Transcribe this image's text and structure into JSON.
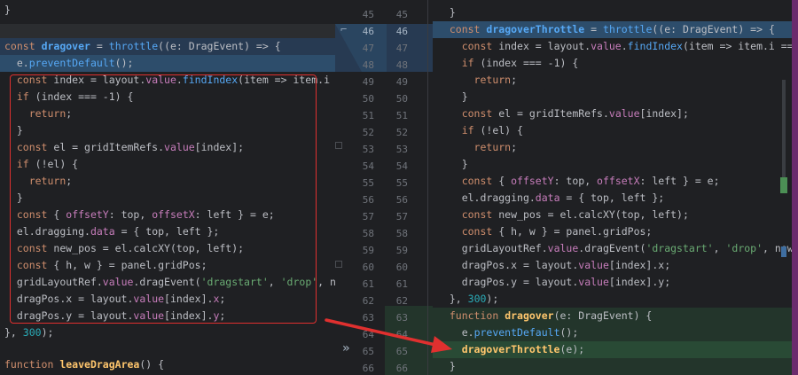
{
  "left": {
    "line_top": "}",
    "line_declare": [
      "const",
      "dragover",
      "=",
      "throttle",
      "((e: DragEvent) => {"
    ],
    "l_prevent": [
      "e.",
      "preventDefault",
      "();"
    ],
    "l_index": [
      "const index = layout.",
      "value",
      ".",
      "findIndex",
      "(item => item.i =="
    ],
    "l_if1": [
      "if",
      " (index === -1) {"
    ],
    "l_return1": [
      "return",
      ";"
    ],
    "l_close1": "}",
    "l_el": [
      "const el = gridItemRefs.",
      "value",
      "[index];"
    ],
    "l_if2": [
      "if",
      " (!el) {"
    ],
    "l_return2": [
      "return",
      ";"
    ],
    "l_close2": "}",
    "l_offset": [
      "const { ",
      "offsetY",
      ": top, ",
      "offsetX",
      ": left } = e;"
    ],
    "l_dragging": [
      "el.dragging.",
      "data",
      " = { top, left };"
    ],
    "l_newpos": [
      "const new_pos = el.calcXY(top, left);"
    ],
    "l_hw": [
      "const { h, w } = panel.gridPos;"
    ],
    "l_grid": [
      "gridLayoutRef.",
      "value",
      ".dragEvent(",
      "'dragstart'",
      ", ",
      "'drop'",
      ", new"
    ],
    "l_dragx": [
      "dragPos.x = layout.",
      "value",
      "[index].",
      "x",
      ";"
    ],
    "l_dragy": [
      "dragPos.y = layout.",
      "value",
      "[index].",
      "y",
      ";"
    ],
    "l_end": [
      "}, ",
      "300",
      ");"
    ],
    "l_leave": [
      "function",
      "leaveDragArea",
      "() {"
    ]
  },
  "gutter": {
    "left_numbers": [
      "45",
      "46",
      "47",
      "48",
      "49",
      "50",
      "51",
      "52",
      "53",
      "54",
      "55",
      "56",
      "57",
      "58",
      "59",
      "60",
      "61",
      "62",
      "63",
      "64",
      "65",
      "66"
    ],
    "right_numbers": [
      "45",
      "46",
      "47",
      "48",
      "49",
      "50",
      "51",
      "52",
      "53",
      "54",
      "55",
      "56",
      "57",
      "58",
      "59",
      "60",
      "61",
      "62",
      "63",
      "64",
      "65",
      "66"
    ],
    "chevron": "»"
  },
  "right": {
    "r_close": "}",
    "r_declare": [
      "const",
      "dragoverThrottle",
      "=",
      "throttle",
      "((e: DragEvent) => {"
    ],
    "r_index": [
      "const index = layout.",
      "value",
      ".",
      "findIndex",
      "(item => item.i ==="
    ],
    "r_if1": [
      "if",
      " (index === -1) {"
    ],
    "r_return1": [
      "return",
      ";"
    ],
    "r_close1": "}",
    "r_el": [
      "const el = gridItemRefs.",
      "value",
      "[index];"
    ],
    "r_if2": [
      "if",
      " (!el) {"
    ],
    "r_return2": [
      "return",
      ";"
    ],
    "r_close2": "}",
    "r_offset": [
      "const { ",
      "offsetY",
      ": top, ",
      "offsetX",
      ": left } = e;"
    ],
    "r_dragging": [
      "el.dragging.",
      "data",
      " = { top, left };"
    ],
    "r_newpos": [
      "const new_pos = el.calcXY(top, left);"
    ],
    "r_hw": [
      "const { h, w } = panel.gridPos;"
    ],
    "r_grid": [
      "gridLayoutRef.",
      "value",
      ".dragEvent(",
      "'dragstart'",
      ", ",
      "'drop'",
      ", new_p"
    ],
    "r_dragx": [
      "dragPos.x = layout.",
      "value",
      "[index].x;"
    ],
    "r_dragy": [
      "dragPos.y = layout.",
      "value",
      "[index].y;"
    ],
    "r_end": [
      "}, ",
      "300",
      ");"
    ],
    "r_func": [
      "function",
      "dragover",
      "(e: DragEvent) {"
    ],
    "r_prevent": [
      "e.",
      "preventDefault",
      "();"
    ],
    "r_call": [
      "dragoverThrottle",
      "(e);"
    ],
    "r_close3": "}"
  },
  "colors": {
    "keyword": "#cf8e6d",
    "function": "#56a8f5",
    "property": "#c77dbb",
    "string": "#6aab73",
    "number": "#2aacb8",
    "annotation_red": "#e0302f"
  }
}
